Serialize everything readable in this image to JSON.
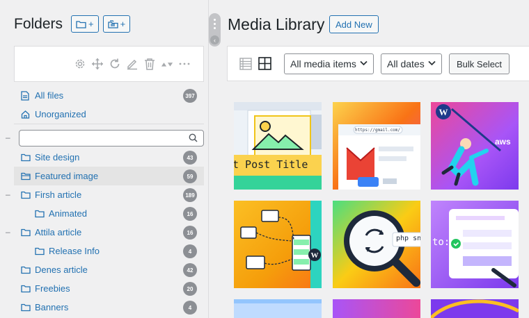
{
  "folders": {
    "title": "Folders",
    "new_folder_btn": "+",
    "new_subfolder_btn": "+",
    "search_placeholder": "",
    "items": [
      {
        "label": "All files",
        "count": "397"
      },
      {
        "label": "Unorganized",
        "count": ""
      },
      {
        "label": "Site design",
        "count": "43"
      },
      {
        "label": "Featured image",
        "count": "59"
      },
      {
        "label": "Firsh article",
        "count": "189"
      },
      {
        "label": "Animated",
        "count": "16"
      },
      {
        "label": "Attila article",
        "count": "16"
      },
      {
        "label": "Release Info",
        "count": "4"
      },
      {
        "label": "Denes article",
        "count": "42"
      },
      {
        "label": "Freebies",
        "count": "20"
      },
      {
        "label": "Banners",
        "count": "4"
      }
    ],
    "toggle_collapse": "–"
  },
  "media": {
    "title": "Media Library",
    "add_new": "Add New",
    "filter_type": "All media items",
    "filter_date": "All dates",
    "bulk_select": "Bulk Select",
    "thumb_post_title": "t Post Title",
    "thumb_url": "https://gmail.com/",
    "thumb_aws": "aws",
    "thumb_php": "php sn",
    "thumb_to": "to:"
  },
  "colors": {
    "accent": "#2271b1",
    "selected_bg": "#e4e4e4",
    "badge": "#8c8f94"
  }
}
